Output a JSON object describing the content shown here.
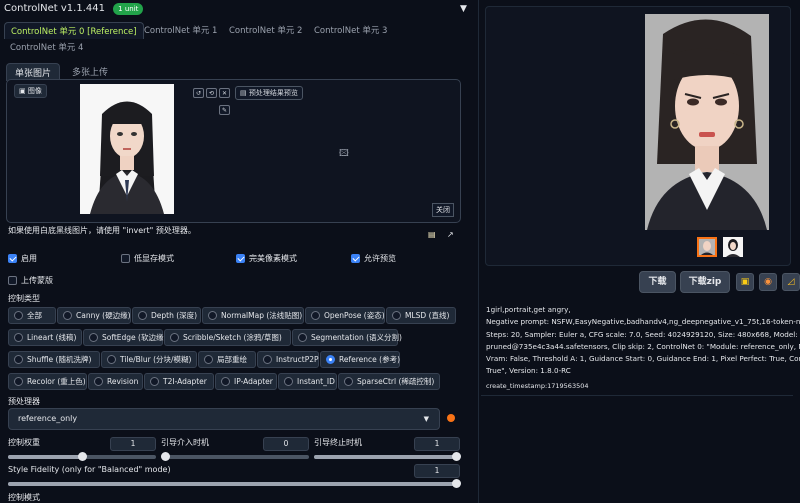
{
  "controlnet": {
    "title": "ControlNet v1.1.441",
    "badge": "1 unit",
    "tabs": [
      {
        "label": "ControlNet 单元 0 [Reference]"
      },
      {
        "label": "ControlNet 单元 1"
      },
      {
        "label": "ControlNet 单元 2"
      },
      {
        "label": "ControlNet 单元 3"
      },
      {
        "label": "ControlNet 单元 4"
      }
    ],
    "subtabs": [
      {
        "label": "单张图片"
      },
      {
        "label": "多张上传"
      }
    ],
    "image_tag": "图像",
    "preview_button": "预处理结果预览",
    "close_button": "关闭",
    "invert_note": "如果使用白底黑线图片，请使用 \"invert\" 预处理器。",
    "checkboxes": [
      {
        "label": "启用",
        "checked": true
      },
      {
        "label": "低显存模式",
        "checked": false
      },
      {
        "label": "完美像素模式",
        "checked": true
      },
      {
        "label": "允许预览",
        "checked": true
      }
    ],
    "upload_mask": {
      "label": "上传蒙版",
      "checked": false
    },
    "control_type_label": "控制类型",
    "control_types": [
      {
        "label": "全部",
        "selected": false
      },
      {
        "label": "Canny (硬边缘)",
        "selected": false
      },
      {
        "label": "Depth (深度)",
        "selected": false
      },
      {
        "label": "NormalMap (法线贴图)",
        "selected": false
      },
      {
        "label": "OpenPose (姿态)",
        "selected": false
      },
      {
        "label": "MLSD (直线)",
        "selected": false
      },
      {
        "label": "Lineart (线稿)",
        "selected": false
      },
      {
        "label": "SoftEdge (软边缘)",
        "selected": false
      },
      {
        "label": "Scribble/Sketch (涂鸦/草图)",
        "selected": false
      },
      {
        "label": "Segmentation (语义分割)",
        "selected": false
      },
      {
        "label": "Shuffle (随机洗牌)",
        "selected": false
      },
      {
        "label": "Tile/Blur (分块/模糊)",
        "selected": false
      },
      {
        "label": "局部重绘",
        "selected": false
      },
      {
        "label": "InstructP2P",
        "selected": false
      },
      {
        "label": "Reference (参考)",
        "selected": true
      },
      {
        "label": "Recolor (重上色)",
        "selected": false
      },
      {
        "label": "Revision",
        "selected": false
      },
      {
        "label": "T2I-Adapter",
        "selected": false
      },
      {
        "label": "IP-Adapter",
        "selected": false
      },
      {
        "label": "Instant_ID",
        "selected": false
      },
      {
        "label": "SparseCtrl (稀疏控制)",
        "selected": false
      }
    ],
    "preprocessor_label": "预处理器",
    "preprocessor_value": "reference_only",
    "weight_label": "控制权重",
    "weight_value": "1",
    "start_label": "引导介入时机",
    "start_value": "0",
    "end_label": "引导终止时机",
    "end_value": "1",
    "fidelity_label": "Style Fidelity (only for \"Balanced\" mode)",
    "fidelity_value": "1",
    "mode_label": "控制模式",
    "slider_levels": {
      "weight": 0.5,
      "start": 0.0,
      "end": 1.0,
      "fidelity": 1.0
    }
  },
  "output": {
    "buttons": {
      "download": "下载",
      "download_zip": "下载zip"
    },
    "icons": [
      "image-icon",
      "palette-icon",
      "ruler-icon"
    ],
    "info_lines": [
      "1girl,portrait,get angry,",
      "Negative prompt: NSFW,EasyNegative,badhandv4,ng_deepnegative_v1_75t,16-token-negative-de",
      "Steps: 20, Sampler: Euler a, CFG scale: 7.0, Seed: 4024929120, Size: 480x668, Model: 683_3660_430",
      "pruned@735e4c3a44.safetensors, Clip skip: 2, ControlNet 0: \"Module: reference_only, Model: Non",
      "Vram: False, Threshold A: 1, Guidance Start: 0, Guidance End: 1, Pixel Perfect: True, Control Mode: ",
      "True\", Version: 1.8.0-RC"
    ],
    "timestamp": "create_timestamp:1719563504"
  },
  "colors": {
    "accent": "#3b82f6",
    "tab_active": "#bef264",
    "badge": "#22a34a",
    "bg": "#0b0f19"
  }
}
